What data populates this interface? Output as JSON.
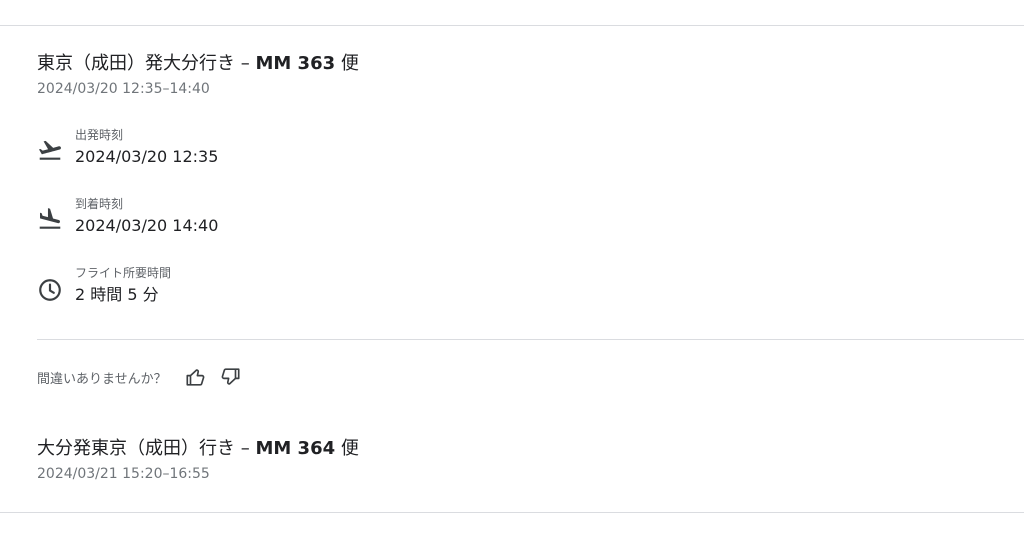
{
  "flights": [
    {
      "title": "東京（成田）発大分行き",
      "flight_number": "MM 363",
      "flight_suffix": "便",
      "schedule": "2024/03/20 12:35–14:40",
      "departure": {
        "label": "出発時刻",
        "value": "2024/03/20 12:35",
        "icon": "flight-takeoff-icon"
      },
      "arrival": {
        "label": "到着時刻",
        "value": "2024/03/20 14:40",
        "icon": "flight-land-icon"
      },
      "duration": {
        "label": "フライト所要時間",
        "value": "2 時間 5 分",
        "icon": "clock-icon"
      }
    },
    {
      "title": "大分発東京（成田）行き",
      "flight_number": "MM 364",
      "flight_suffix": "便",
      "schedule": "2024/03/21 15:20–16:55"
    }
  ],
  "feedback": {
    "question": "間違いありませんか？",
    "thumbs_up_icon": "thumbs-up-icon",
    "thumbs_down_icon": "thumbs-down-icon"
  },
  "colors": {
    "text_primary": "#202124",
    "text_secondary": "#70757a",
    "divider": "#dadce0",
    "icon": "#3c4043"
  }
}
